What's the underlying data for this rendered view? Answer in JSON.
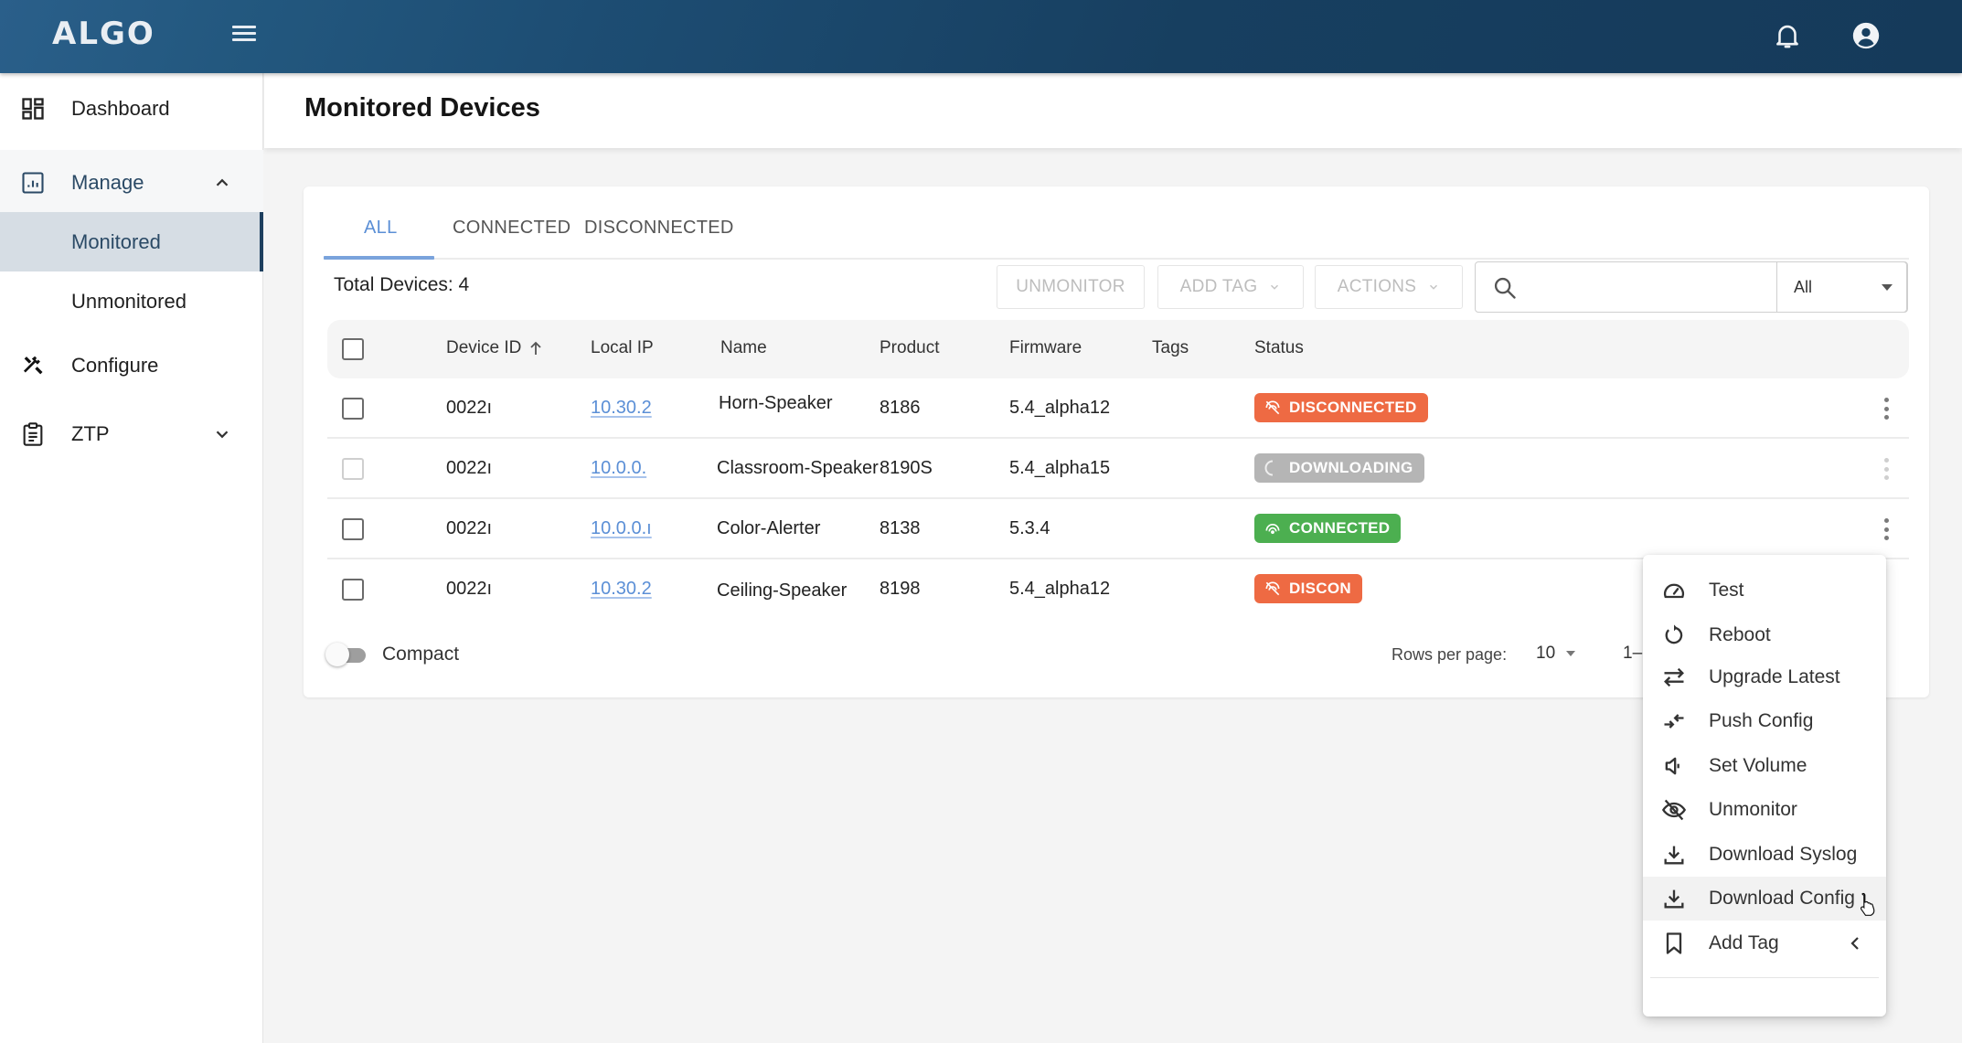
{
  "header": {
    "logo": "ALGO",
    "icons": [
      "menu-icon",
      "bell-icon",
      "account-icon"
    ]
  },
  "sidebar": {
    "items": [
      {
        "label": "Dashboard",
        "icon": "dashboard-icon"
      },
      {
        "label": "Manage",
        "icon": "manage-icon",
        "expanded": true
      },
      {
        "label": "Monitored",
        "active": true
      },
      {
        "label": "Unmonitored"
      },
      {
        "label": "Configure",
        "icon": "tools-icon"
      },
      {
        "label": "ZTP",
        "icon": "clipboard-icon",
        "expanded": false
      }
    ]
  },
  "page": {
    "title": "Monitored Devices"
  },
  "tabs": [
    {
      "label": "ALL",
      "active": true
    },
    {
      "label": "CONNECTED"
    },
    {
      "label": "DISCONNECTED"
    }
  ],
  "toolbar": {
    "total_label": "Total Devices: 4",
    "unmonitor_label": "UNMONITOR",
    "add_tag_label": "ADD TAG",
    "actions_label": "ACTIONS",
    "search_value": "",
    "filter_value": "All"
  },
  "table": {
    "columns": [
      "Device ID",
      "Local IP",
      "Name",
      "Product",
      "Firmware",
      "Tags",
      "Status"
    ],
    "sort_column": "Device ID",
    "sort_direction": "ascending",
    "rows": [
      {
        "device_id": "0022ı",
        "local_ip": "10.30.2",
        "name": "Horn-Speaker",
        "product": "8186",
        "firmware": "5.4_alpha12",
        "tags": "",
        "status": "DISCONNECTED"
      },
      {
        "device_id": "0022ı",
        "local_ip": "10.0.0.",
        "name": "Classroom-Speaker",
        "product": "8190S",
        "firmware": "5.4_alpha15",
        "tags": "",
        "status": "DOWNLOADING"
      },
      {
        "device_id": "0022ı",
        "local_ip": "10.0.0.ı",
        "name": "Color-Alerter",
        "product": "8138",
        "firmware": "5.3.4",
        "tags": "",
        "status": "CONNECTED"
      },
      {
        "device_id": "0022ı",
        "local_ip": "10.30.2",
        "name": "Ceiling-Speaker",
        "product": "8198",
        "firmware": "5.4_alpha12",
        "tags": "",
        "status": "DISCON"
      }
    ]
  },
  "status_colors": {
    "DISCONNECTED": "#ee6a43",
    "DOWNLOADING": "#b5b5b5",
    "CONNECTED": "#4caf50"
  },
  "footer": {
    "compact_label": "Compact",
    "compact_on": false,
    "rows_per_page_label": "Rows per page:",
    "rows_per_page_value": "10",
    "range_text": "1–"
  },
  "context_menu": {
    "items": [
      {
        "label": "Test",
        "icon": "speedometer-icon"
      },
      {
        "label": "Reboot",
        "icon": "restart-icon"
      },
      {
        "label": "Upgrade Latest",
        "icon": "swap-arrows-icon"
      },
      {
        "label": "Push Config",
        "icon": "push-arrows-icon"
      },
      {
        "label": "Set Volume",
        "icon": "volume-icon"
      },
      {
        "label": "Unmonitor",
        "icon": "eye-off-icon"
      },
      {
        "label": "Download Syslog",
        "icon": "download-icon"
      },
      {
        "label": "Download Config",
        "icon": "download-icon",
        "hovered": true
      },
      {
        "label": "Add Tag",
        "icon": "bookmark-icon",
        "has_submenu": true
      }
    ]
  },
  "accent_color": "#5b8fd6"
}
